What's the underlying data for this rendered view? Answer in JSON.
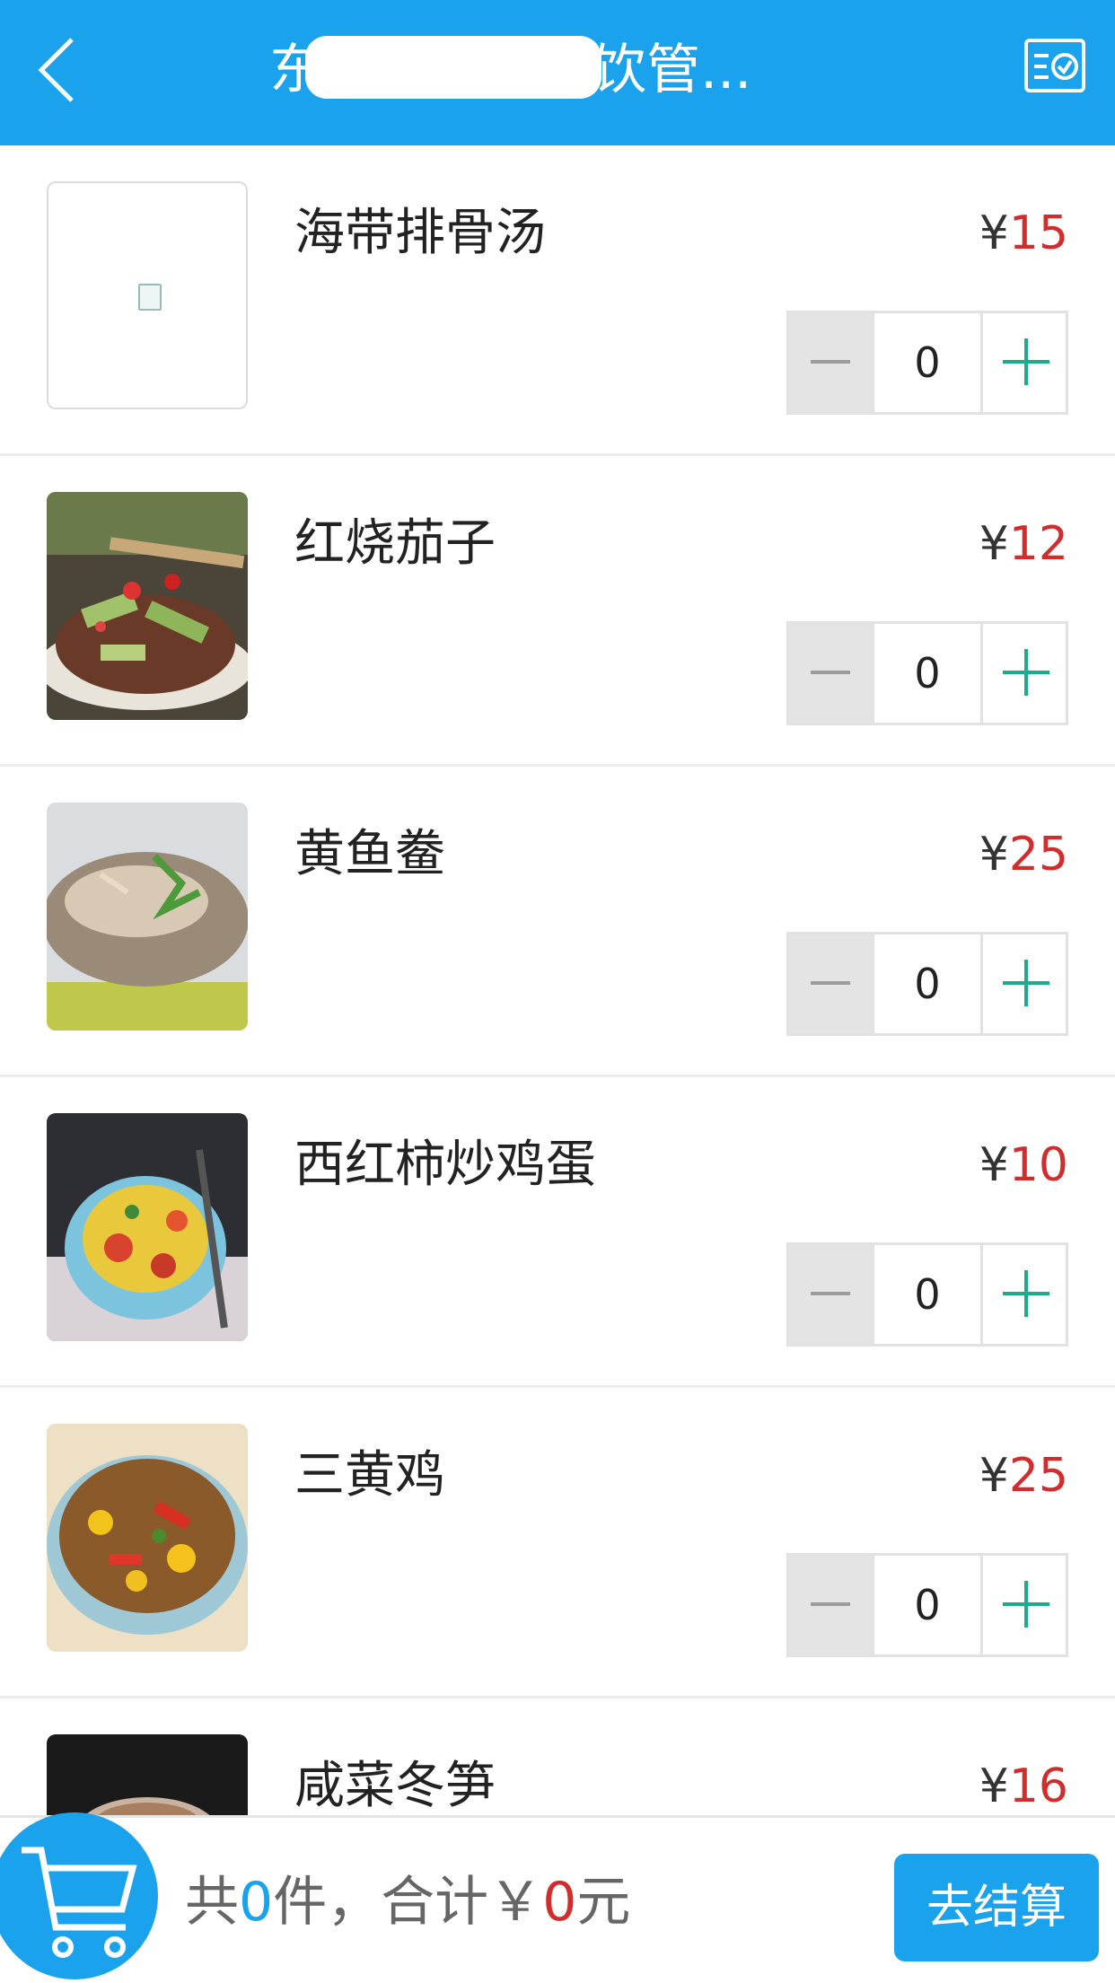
{
  "header": {
    "title": "东门…芸香餐饮管...",
    "back_icon": "chevron-left-icon",
    "action_icon": "receipt-check-icon",
    "bg_color": "#1aa3ec"
  },
  "items": [
    {
      "name": "海带排骨汤",
      "currency": "¥",
      "price": "15",
      "qty": "0"
    },
    {
      "name": "红烧茄子",
      "currency": "¥",
      "price": "12",
      "qty": "0"
    },
    {
      "name": "黄鱼鲞",
      "currency": "¥",
      "price": "25",
      "qty": "0"
    },
    {
      "name": "西红柿炒鸡蛋",
      "currency": "¥",
      "price": "10",
      "qty": "0"
    },
    {
      "name": "三黄鸡",
      "currency": "¥",
      "price": "25",
      "qty": "0"
    },
    {
      "name": "咸菜冬笋",
      "currency": "¥",
      "price": "16",
      "qty": ""
    }
  ],
  "footer": {
    "prefix": "共",
    "count": "0",
    "mid": "件，合计￥",
    "amount": "0",
    "suffix": "元",
    "checkout_label": "去结算",
    "cart_icon": "shopping-cart-icon"
  }
}
